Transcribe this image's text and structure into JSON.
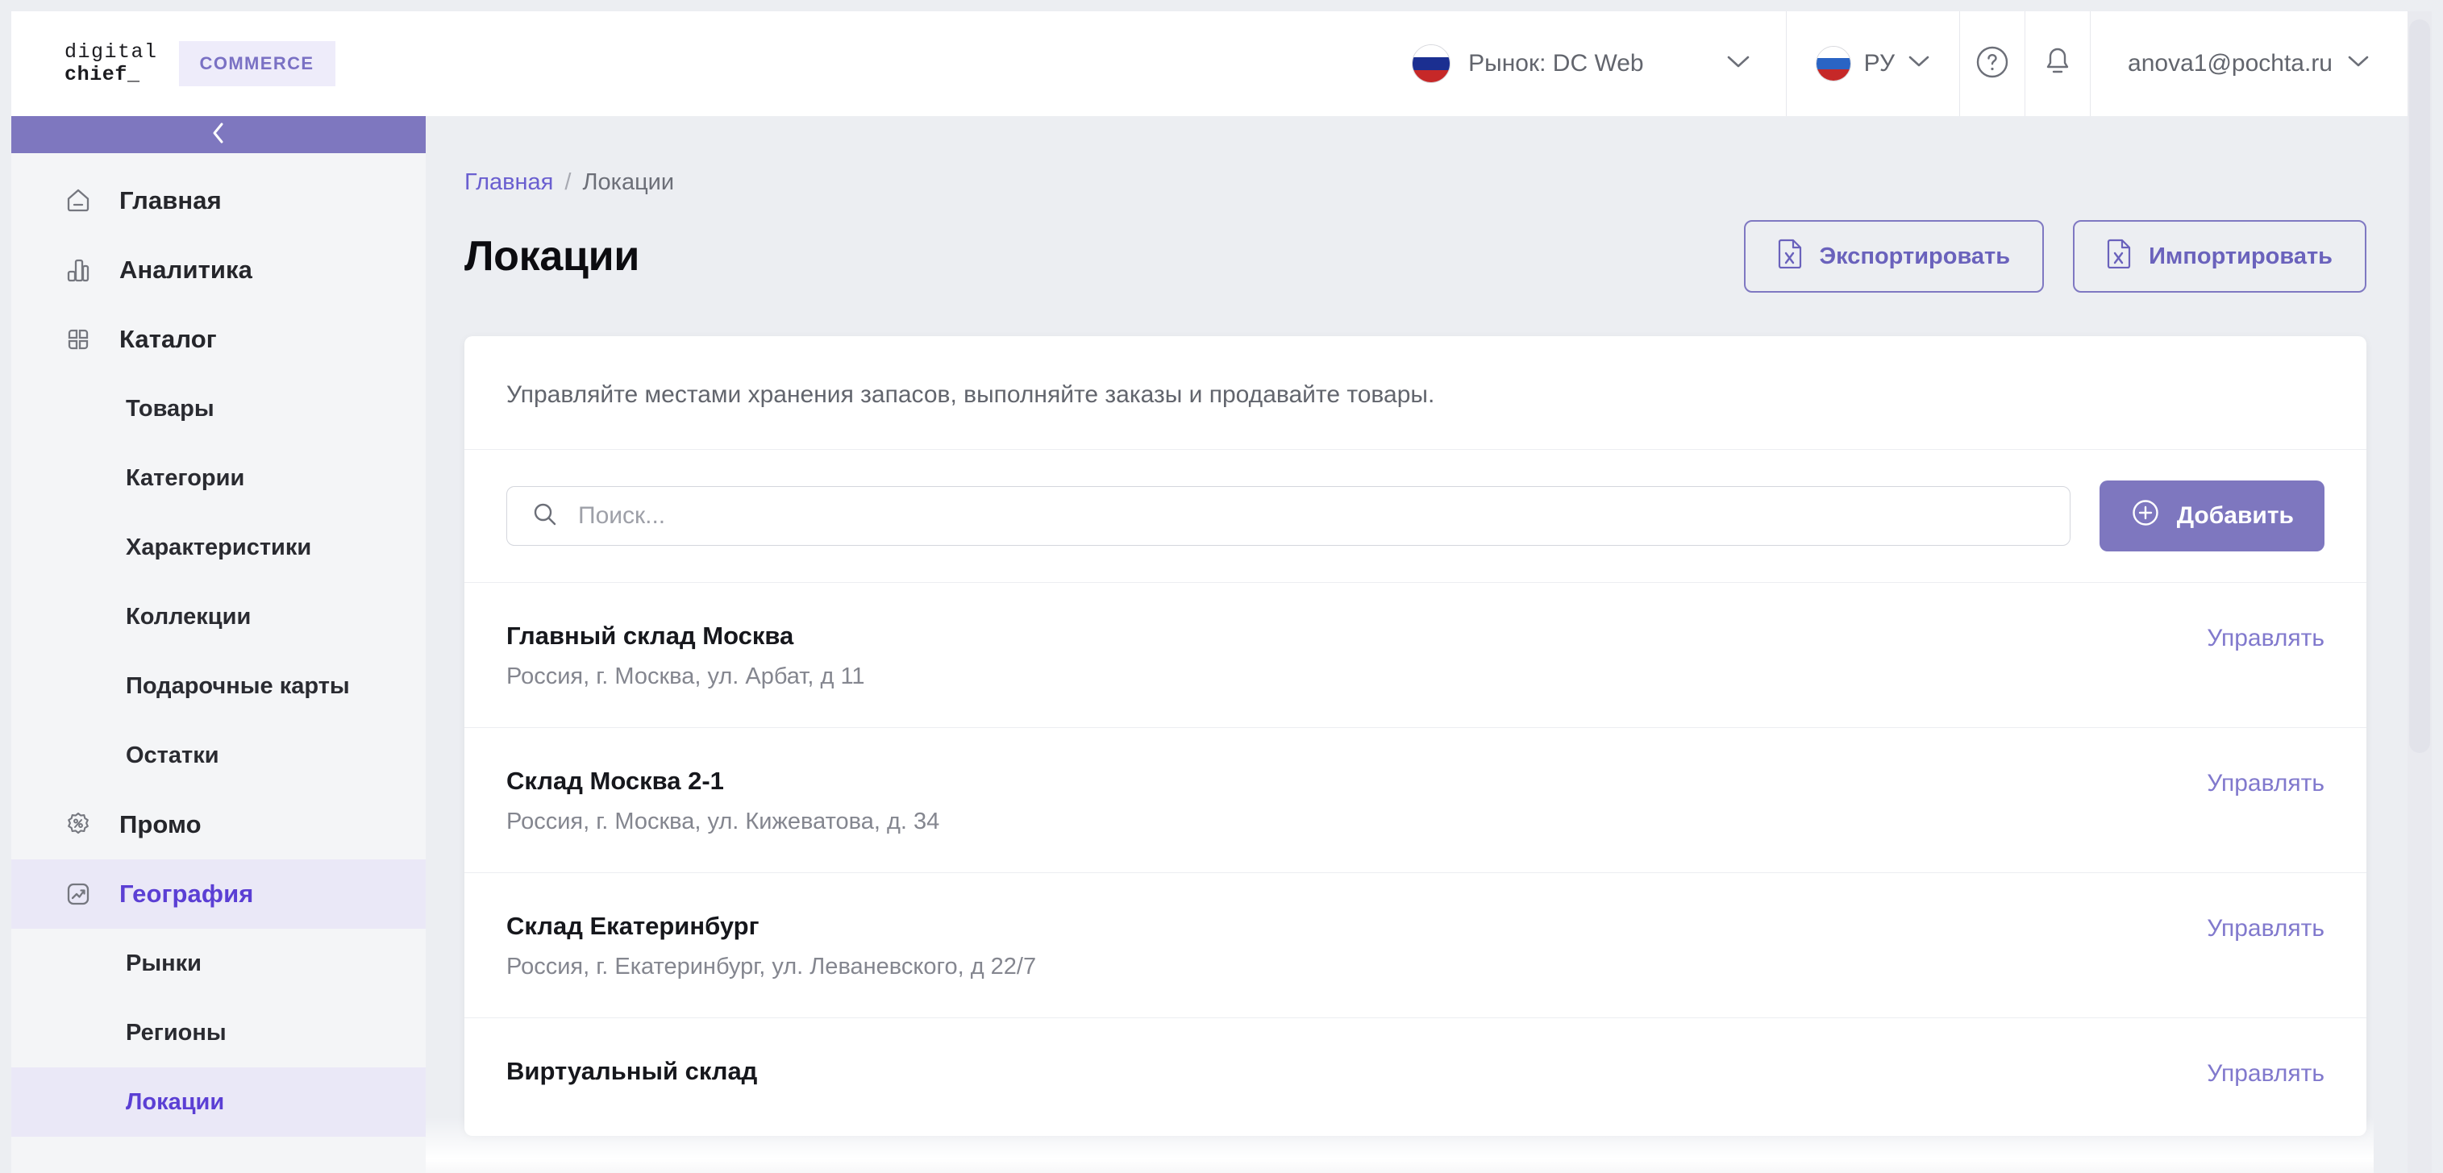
{
  "brand": {
    "logo_line1": "digital",
    "logo_line2": "chief_",
    "badge": "COMMERCE"
  },
  "header": {
    "market_label": "Рынок: DC Web",
    "language_label": "РУ",
    "help_icon": "question-circle-icon",
    "notifications_icon": "bell-icon",
    "user_email": "anova1@pochta.ru",
    "caret_icon": "chevron-down-icon"
  },
  "sidebar": {
    "collapse_icon": "chevron-left-icon",
    "items": [
      {
        "label": "Главная",
        "icon": "home-icon",
        "type": "top",
        "active": false
      },
      {
        "label": "Аналитика",
        "icon": "bar-chart-icon",
        "type": "top",
        "active": false
      },
      {
        "label": "Каталог",
        "icon": "grid-icon",
        "type": "top",
        "active": false
      },
      {
        "label": "Товары",
        "type": "sub",
        "active": false
      },
      {
        "label": "Категории",
        "type": "sub",
        "active": false
      },
      {
        "label": "Характеристики",
        "type": "sub",
        "active": false
      },
      {
        "label": "Коллекции",
        "type": "sub",
        "active": false
      },
      {
        "label": "Подарочные карты",
        "type": "sub",
        "active": false
      },
      {
        "label": "Остатки",
        "type": "sub",
        "active": false
      },
      {
        "label": "Промо",
        "icon": "percent-badge-icon",
        "type": "top",
        "active": false
      },
      {
        "label": "География",
        "icon": "trend-square-icon",
        "type": "top",
        "active": true
      },
      {
        "label": "Рынки",
        "type": "sub",
        "active": false
      },
      {
        "label": "Регионы",
        "type": "sub",
        "active": false
      },
      {
        "label": "Локации",
        "type": "sub",
        "active": true
      }
    ]
  },
  "breadcrumb": {
    "home": "Главная",
    "separator": "/",
    "current": "Локации"
  },
  "page": {
    "title": "Локации",
    "export_label": "Экспортировать",
    "import_label": "Импортировать",
    "export_icon": "xls-file-icon",
    "import_icon": "xls-file-icon"
  },
  "card": {
    "description": "Управляйте местами хранения запасов, выполняйте заказы и продавайте товары.",
    "search_placeholder": "Поиск...",
    "search_value": "",
    "search_icon": "search-icon",
    "add_label": "Добавить",
    "add_icon": "plus-circle-icon",
    "manage_label": "Управлять"
  },
  "locations": [
    {
      "name": "Главный склад Москва",
      "address": "Россия, г. Москва, ул. Арбат, д 11",
      "manage": "Управлять"
    },
    {
      "name": "Склад Москва 2-1",
      "address": "Россия, г. Москва, ул. Кижеватова, д. 34",
      "manage": "Управлять"
    },
    {
      "name": "Склад Екатеринбург",
      "address": "Россия, г. Екатеринбург, ул. Леваневского, д 22/7",
      "manage": "Управлять"
    },
    {
      "name": "Виртуальный склад",
      "address": "",
      "manage": "Управлять"
    }
  ],
  "colors": {
    "accent_purple": "#7e77bf",
    "active_purple": "#5b3fd4",
    "link_purple": "#6a5fd0",
    "page_bg": "#eceef2",
    "sidebar_bg": "#f4f5f7",
    "active_bg": "#eae8f7"
  }
}
